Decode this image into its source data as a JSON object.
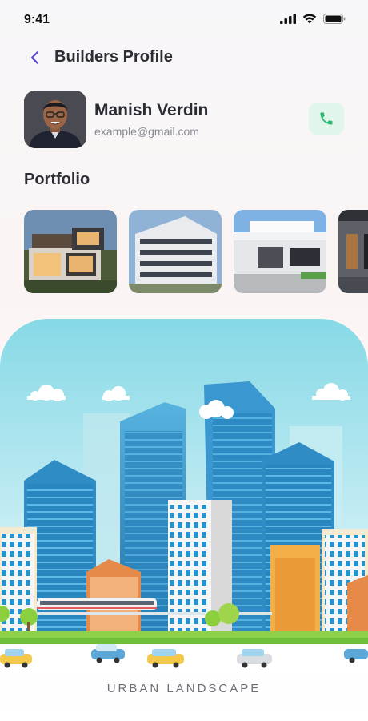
{
  "status_bar": {
    "time": "9:41"
  },
  "header": {
    "title": "Builders Profile"
  },
  "profile": {
    "name": "Manish Verdin",
    "email": "example@gmail.com"
  },
  "portfolio": {
    "title": "Portfolio",
    "items": [
      "modern-house",
      "apartment-block",
      "garage-villa",
      "dark-building"
    ]
  },
  "banner": {
    "caption": "URBAN LANDSCAPE"
  },
  "colors": {
    "accent": "#5b48d6",
    "call_bg": "#e0f6ea",
    "call_icon": "#2bb673",
    "sky": "#8ed9e8"
  }
}
